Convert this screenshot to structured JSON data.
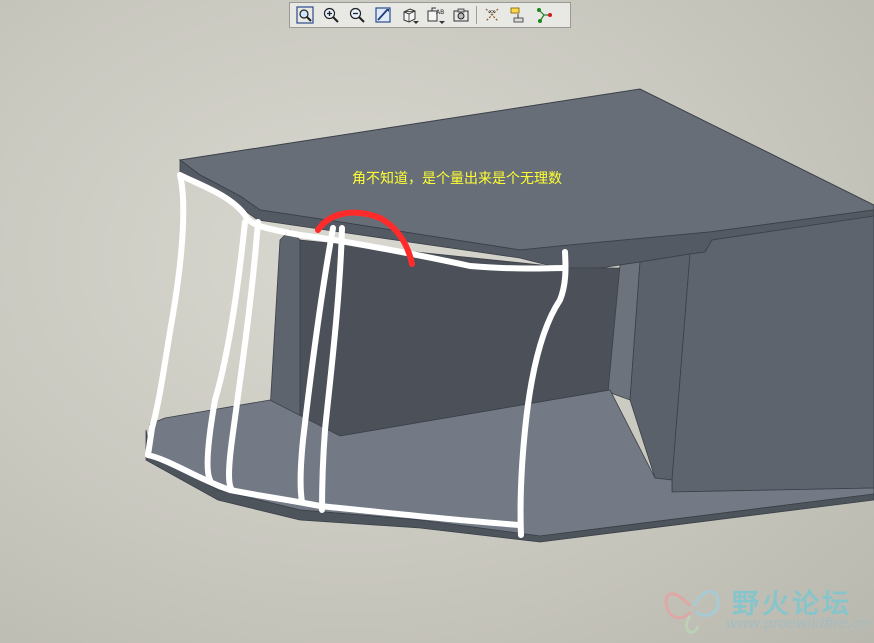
{
  "toolbar": {
    "buttons": [
      {
        "icon": "zoom-fit-icon"
      },
      {
        "icon": "zoom-in-icon"
      },
      {
        "icon": "zoom-out-icon"
      },
      {
        "icon": "repaint-icon"
      },
      {
        "icon": "view-style-icon",
        "dropdown": true
      },
      {
        "icon": "saved-views-icon",
        "dropdown": true
      },
      {
        "icon": "view-manager-icon"
      },
      {
        "icon": "datum-axis-icon"
      },
      {
        "icon": "datum-plane-icon"
      },
      {
        "icon": "datum-point-icon"
      }
    ]
  },
  "annotation": {
    "text": "角不知道，是个量出来是个无理数",
    "color": "#ffff33"
  },
  "sketch": {
    "stroke_white": "#ffffff",
    "stroke_red": "#ff2a2a"
  },
  "model": {
    "top_face": "#656c76",
    "inner_wall": "#4f545c",
    "side_face": "#5b626b",
    "floor": "#747b86",
    "edge": "#3b4048"
  },
  "watermark": {
    "title": "野火论坛",
    "url": "www.proewildfire.cn"
  }
}
